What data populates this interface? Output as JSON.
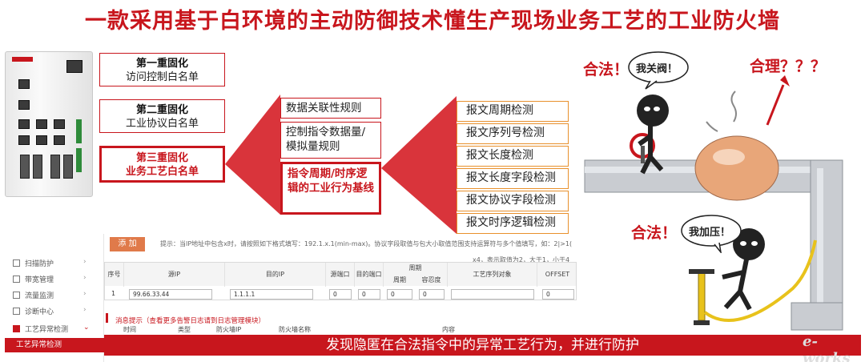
{
  "title": "一款采用基于白环境的主动防御技术懂生产现场业务工艺的工业防火墙",
  "levels": [
    {
      "title": "第一重固化",
      "sub": "访问控制白名单"
    },
    {
      "title": "第二重固化",
      "sub": "工业协议白名单"
    },
    {
      "title": "第三重固化",
      "sub": "业务工艺白名单"
    }
  ],
  "rules": [
    {
      "text": "数据关联性规则"
    },
    {
      "text": "控制指令数据量/模拟量规则"
    },
    {
      "text": "指令周期/时序逻辑的工业行为基线"
    }
  ],
  "checks": [
    "报文周期检测",
    "报文序列号检测",
    "报文长度检测",
    "报文长度字段检测",
    "报文协议字段检测",
    "报文时序逻辑检测"
  ],
  "cartoon": {
    "legal_top": "合法！",
    "bubble_top": "我关阀！",
    "reason": "合理？？？",
    "legal_bottom": "合法！",
    "bubble_bottom": "我加压！"
  },
  "ui": {
    "sidebar": [
      "扫描防护",
      "带宽管理",
      "流量监测",
      "诊断中心",
      "工艺异常检测"
    ],
    "sidebar_active": "工艺异常检测",
    "add_label": "添 加",
    "hint": "提示：当IP地址中包含x时，请按照如下格式填写：192.1.x.1(min-max)。协议字段取值与包大小取值范围支持运算符与多个值填写，如：2|>1(",
    "hint2": "x4，表示取值为2，大于1，小于4",
    "headers": [
      "序号",
      "源IP",
      "目的IP",
      "源端口",
      "目的端口",
      "周期",
      "容忍度",
      "工艺序列对象",
      "OFFSET"
    ],
    "header_group": "周期",
    "row": {
      "index": "1",
      "src_ip": "99.66.33.44",
      "dst_ip": "1.1.1.1",
      "src_port": "0",
      "dst_port": "0",
      "period": "0",
      "tolerance": "0",
      "offset": "0"
    },
    "message": "消息提示（查看更多告警日志请到日志管理模块）",
    "message_cols": [
      "时间",
      "类型",
      "防火墙IP",
      "防火墙名称",
      "内容"
    ]
  },
  "banner": "发现隐匿在合法指令中的异常工艺行为，并进行防护",
  "brand": "e-works"
}
